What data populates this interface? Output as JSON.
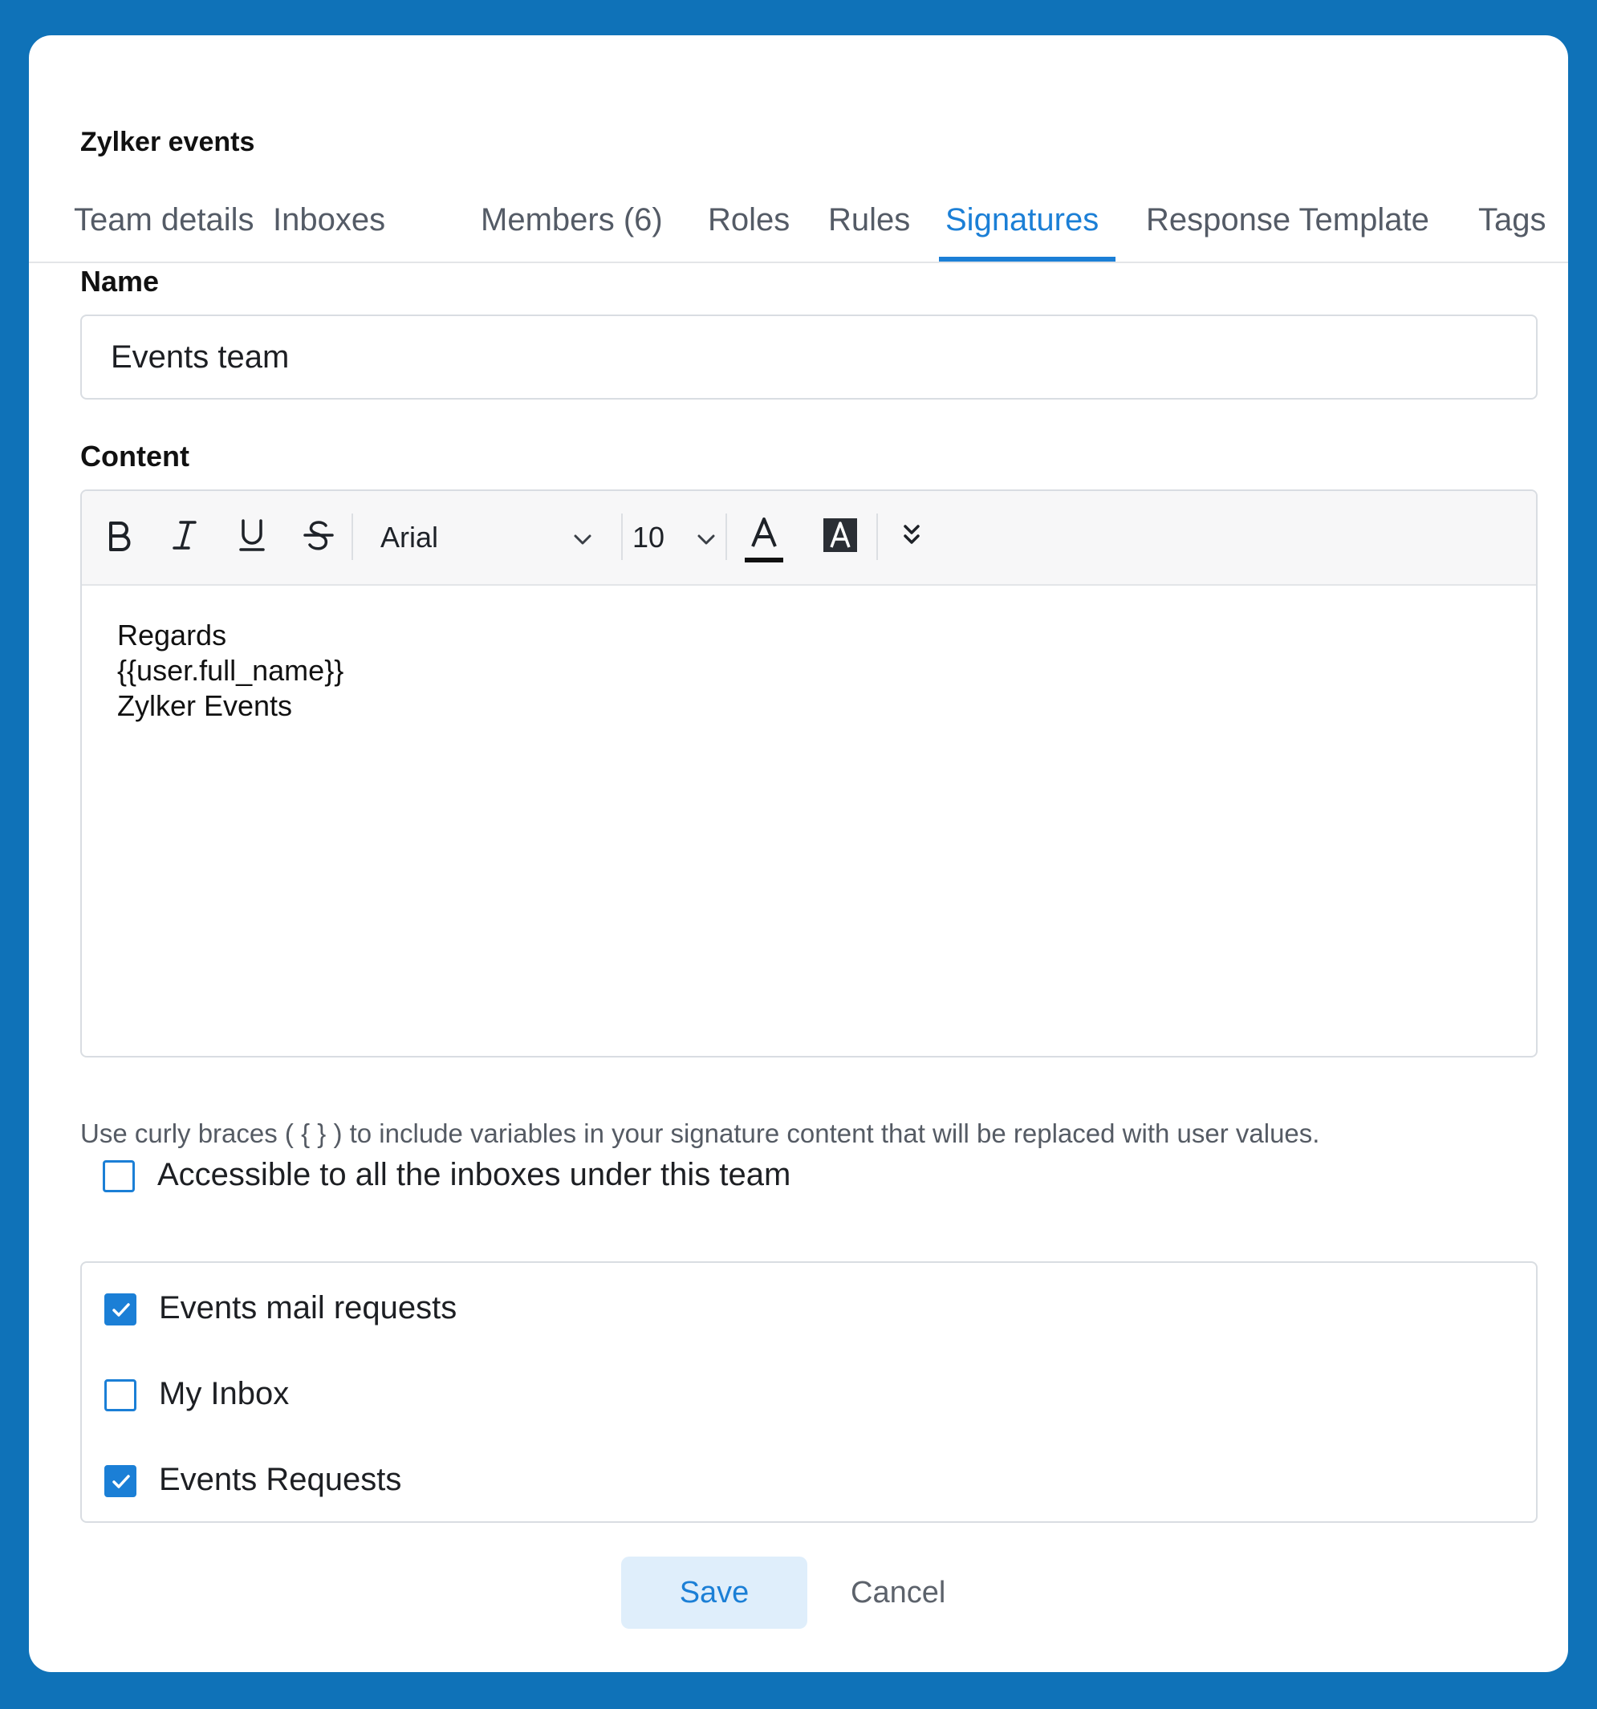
{
  "header": {
    "team_title": "Zylker events"
  },
  "tabs": [
    {
      "label": "Team details",
      "active": false
    },
    {
      "label": "Inboxes",
      "active": false
    },
    {
      "label": "Members (6)",
      "active": false
    },
    {
      "label": "Roles",
      "active": false
    },
    {
      "label": "Rules",
      "active": false
    },
    {
      "label": "Signatures",
      "active": true
    },
    {
      "label": "Response Template",
      "active": false
    },
    {
      "label": "Tags",
      "active": false
    }
  ],
  "form": {
    "name_label": "Name",
    "name_value": "Events team",
    "content_label": "Content"
  },
  "toolbar": {
    "font_family": "Arial",
    "font_size": "10",
    "icons": [
      "bold-icon",
      "italic-icon",
      "underline-icon",
      "strikethrough-icon",
      "chevron-down-icon",
      "text-color-icon",
      "highlight-icon",
      "more-options-icon"
    ]
  },
  "editor": {
    "lines": [
      "Regards",
      "{{user.full_name}}",
      "Zylker Events"
    ]
  },
  "hint": "Use curly braces ( { } ) to include variables in your signature content that will be replaced with user values.",
  "access": {
    "all_inboxes_label": "Accessible to all the inboxes under this team",
    "all_inboxes_checked": false,
    "inboxes": [
      {
        "label": "Events mail requests",
        "checked": true
      },
      {
        "label": "My Inbox",
        "checked": false
      },
      {
        "label": "Events Requests",
        "checked": true
      }
    ]
  },
  "actions": {
    "save_label": "Save",
    "cancel_label": "Cancel"
  },
  "colors": {
    "background": "#0f72b8",
    "accent": "#1b7fd6",
    "save_bg": "#dfeefb"
  }
}
